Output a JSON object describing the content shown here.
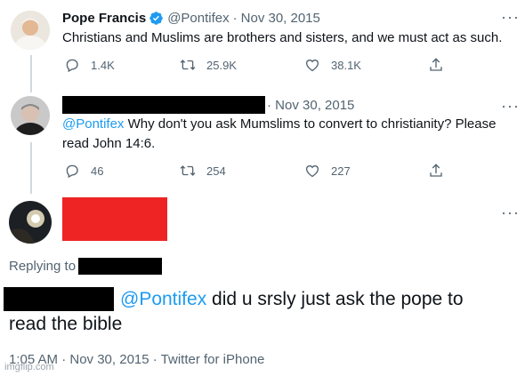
{
  "tweet1": {
    "name": "Pope Francis",
    "handle": "@Pontifex",
    "sep": "·",
    "date": "Nov 30, 2015",
    "text": "Christians and Muslims are brothers and sisters, and we must act as such.",
    "replies": "1.4K",
    "retweets": "25.9K",
    "likes": "38.1K"
  },
  "tweet2": {
    "date": "· Nov 30, 2015",
    "mention": "@Pontifex",
    "text_rest": " Why don't you ask Mumslims to convert to christianity? Please",
    "text_line2": "read John 14:6.",
    "replies": "46",
    "retweets": "254",
    "likes": "227"
  },
  "tweet3": {
    "replying_label": "Replying to",
    "mention": "@Pontifex",
    "text_rest": " did u srsly just ask the pope to",
    "text_line2": "read the bible",
    "meta": "1:05 AM · Nov 30, 2015 · Twitter for iPhone"
  },
  "more_glyph": "···",
  "watermark": "imgflip.com",
  "colors": {
    "verified": "#1d9bf0",
    "mention": "#1d9bf0",
    "muted": "#536471",
    "redaction_red": "#ee2424"
  }
}
